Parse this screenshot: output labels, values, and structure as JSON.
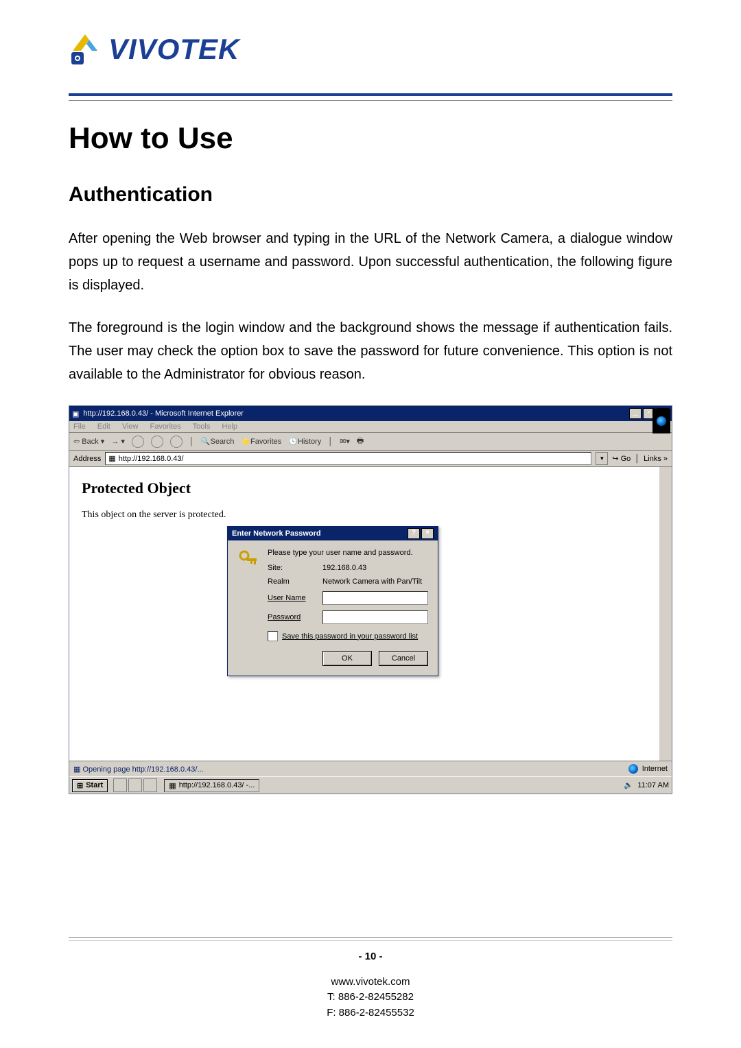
{
  "logo": {
    "text": "VIVOTEK"
  },
  "heading1": "How to Use",
  "heading2": "Authentication",
  "para1": "After opening the Web browser and typing in the URL of the Network Camera, a dialogue window pops up to request a username and password. Upon successful authentication, the following figure is displayed.",
  "para2": "The foreground is the login window and the background shows the message if authentication fails. The user may check the option box to save the password for future convenience.  This option is not available to the Administrator for obvious reason.",
  "ie": {
    "title": "http://192.168.0.43/ - Microsoft Internet Explorer",
    "window_btns": {
      "min": "_",
      "max": "▫",
      "close": "×"
    },
    "menu": [
      "File",
      "Edit",
      "View",
      "Favorites",
      "Tools",
      "Help"
    ],
    "toolbar": {
      "back": "Back",
      "search": "Search",
      "favorites": "Favorites",
      "history": "History"
    },
    "address_label": "Address",
    "address_value": "http://192.168.0.43/",
    "go_label": "Go",
    "links_label": "Links »",
    "page": {
      "h": "Protected Object",
      "p": "This object on the server is protected."
    },
    "dialog": {
      "title": "Enter Network Password",
      "help": "?",
      "close": "×",
      "prompt": "Please type your user name and password.",
      "site_label": "Site:",
      "site_value": "192.168.0.43",
      "realm_label": "Realm",
      "realm_value": "Network  Camera with Pan/Tilt",
      "user_label": "User Name",
      "pass_label": "Password",
      "save_label": "Save this password in your password list",
      "ok": "OK",
      "cancel": "Cancel"
    },
    "status_left": "Opening page http://192.168.0.43/...",
    "status_right": "Internet",
    "taskbar": {
      "start": "Start",
      "task": "http://192.168.0.43/ -...",
      "time": "11:07 AM"
    }
  },
  "footer": {
    "pagenum": "- 10 -",
    "site": "www.vivotek.com",
    "tel": "T: 886-2-82455282",
    "fax": "F: 886-2-82455532"
  }
}
